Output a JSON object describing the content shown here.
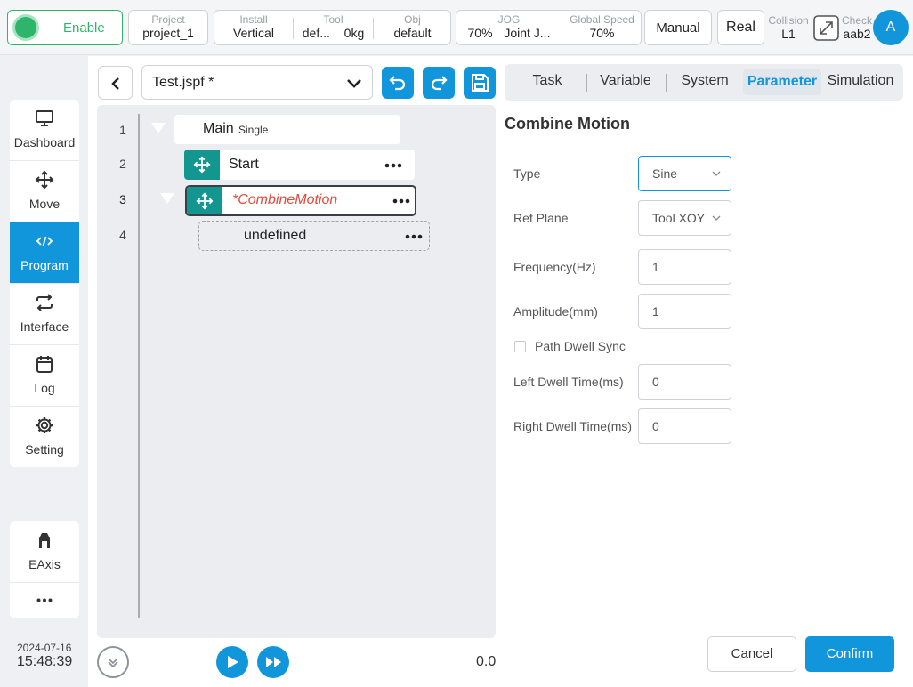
{
  "topbar": {
    "enable_label": "Enable",
    "project": {
      "caption": "Project",
      "value": "project_1"
    },
    "install": {
      "caption": "Install",
      "value": "Vertical"
    },
    "tool": {
      "caption": "Tool",
      "value": "def...",
      "weight": "0kg"
    },
    "obj": {
      "caption": "Obj",
      "value": "default"
    },
    "jog": {
      "caption": "JOG",
      "percent": "70%",
      "mode": "Joint J..."
    },
    "global_speed": {
      "caption": "Global Speed",
      "value": "70%"
    },
    "manual_label": "Manual",
    "real_label": "Real",
    "collision": {
      "caption": "Collision",
      "value": "L1"
    },
    "check": {
      "caption": "Check",
      "value": "aab2"
    },
    "avatar_letter": "A"
  },
  "sidebar": {
    "items": [
      {
        "label": "Dashboard",
        "icon": "monitor-icon"
      },
      {
        "label": "Move",
        "icon": "move-icon"
      },
      {
        "label": "Program",
        "icon": "code-icon",
        "active": true
      },
      {
        "label": "Interface",
        "icon": "exchange-icon"
      },
      {
        "label": "Log",
        "icon": "calendar-icon"
      },
      {
        "label": "Setting",
        "icon": "gear-icon"
      }
    ],
    "extra": [
      {
        "label": "EAxis",
        "icon": "eaxis-icon"
      },
      {
        "label": "...",
        "icon": "more-icon"
      }
    ],
    "date": "2024-07-16",
    "time": "15:48:39"
  },
  "editor": {
    "file_name": "Test.jspf *",
    "lines": [
      {
        "num": "1",
        "label": "Main",
        "sub": "Single"
      },
      {
        "num": "2",
        "label": "Start"
      },
      {
        "num": "3",
        "label": "*CombineMotion"
      },
      {
        "num": "4",
        "label": "undefined"
      }
    ],
    "speed_readout": "0.0"
  },
  "tabs": [
    "Task",
    "Variable",
    "System",
    "Parameter",
    "Simulation"
  ],
  "active_tab": "Parameter",
  "panel": {
    "title": "Combine Motion",
    "type_label": "Type",
    "type_value": "Sine",
    "ref_plane_label": "Ref Plane",
    "ref_plane_value": "Tool XOY",
    "frequency_label": "Frequency(Hz)",
    "frequency_value": "1",
    "amplitude_label": "Amplitude(mm)",
    "amplitude_value": "1",
    "path_dwell_label": "Path Dwell Sync",
    "path_dwell_checked": false,
    "left_dwell_label": "Left Dwell Time(ms)",
    "left_dwell_value": "0",
    "right_dwell_label": "Right Dwell Time(ms)",
    "right_dwell_value": "0",
    "cancel_label": "Cancel",
    "confirm_label": "Confirm"
  },
  "colors": {
    "accent": "#1296db",
    "teal": "#13968f",
    "enable_green": "#2fb56b",
    "error_red": "#e04b3c"
  }
}
